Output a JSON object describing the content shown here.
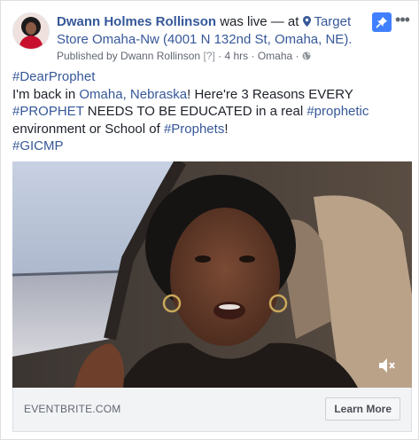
{
  "post": {
    "author": "Dwann Holmes Rollinson",
    "action_text": "was live — at",
    "place": "Target Store Omaha-Nw (4001 N 132nd St, Omaha, NE).",
    "published_by": "Published by Dwann Rollinson",
    "help_mark": "[?]",
    "time": "4 hrs",
    "location": "Omaha",
    "separator": "·"
  },
  "body": {
    "hashtag1": "#DearProphet",
    "text1": "I'm back in ",
    "link_omaha": "Omaha, Nebraska",
    "text2": "! Here're 3 Reasons EVERY ",
    "hashtag_prophet": "#PROPHET",
    "text3": " NEEDS TO BE EDUCATED in a real ",
    "hashtag_prophetic": "#prophetic",
    "text4": " environment or School of ",
    "hashtag_prophets": "#Prophets",
    "text5": "!",
    "hashtag_gicmp": "#GICMP"
  },
  "link_preview": {
    "domain": "EVENTBRITE.COM",
    "cta_label": "Learn More"
  },
  "icons": {
    "pin": "pin-icon",
    "more": "more-options-icon",
    "location": "location-pin-icon",
    "globe": "globe-icon",
    "volume": "mute-icon"
  },
  "colors": {
    "link": "#365899",
    "pin_badge": "#4080ff",
    "footer_bg": "#f2f3f5"
  }
}
